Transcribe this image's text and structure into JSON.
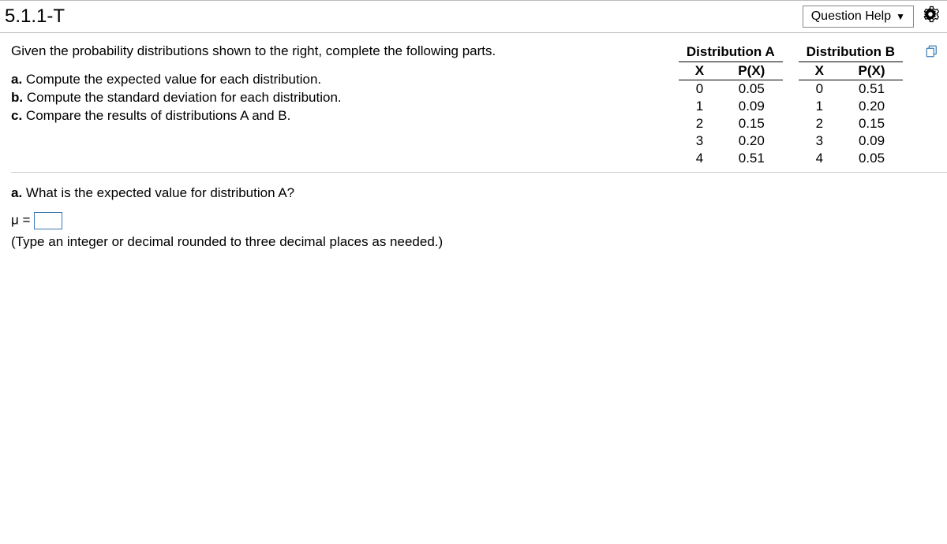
{
  "header": {
    "question_number": "5.1.1-T",
    "help_label": "Question Help"
  },
  "prompt": {
    "intro": "Given the probability distributions shown to the right, complete the following parts.",
    "parts": {
      "a": "a. Compute the expected value for each distribution.",
      "b": "b. Compute the standard deviation for each distribution.",
      "c": "c. Compare the results of distributions A and B."
    }
  },
  "distA": {
    "title": "Distribution A",
    "colX": "X",
    "colP": "P(X)",
    "rows": [
      {
        "x": "0",
        "p": "0.05"
      },
      {
        "x": "1",
        "p": "0.09"
      },
      {
        "x": "2",
        "p": "0.15"
      },
      {
        "x": "3",
        "p": "0.20"
      },
      {
        "x": "4",
        "p": "0.51"
      }
    ]
  },
  "distB": {
    "title": "Distribution B",
    "colX": "X",
    "colP": "P(X)",
    "rows": [
      {
        "x": "0",
        "p": "0.51"
      },
      {
        "x": "1",
        "p": "0.20"
      },
      {
        "x": "2",
        "p": "0.15"
      },
      {
        "x": "3",
        "p": "0.09"
      },
      {
        "x": "4",
        "p": "0.05"
      }
    ]
  },
  "question": {
    "title": "a. What is the expected value for distribution A?",
    "mu_label": "μ =",
    "input_value": "",
    "hint": "(Type an integer or decimal rounded to three decimal places as needed.)"
  }
}
